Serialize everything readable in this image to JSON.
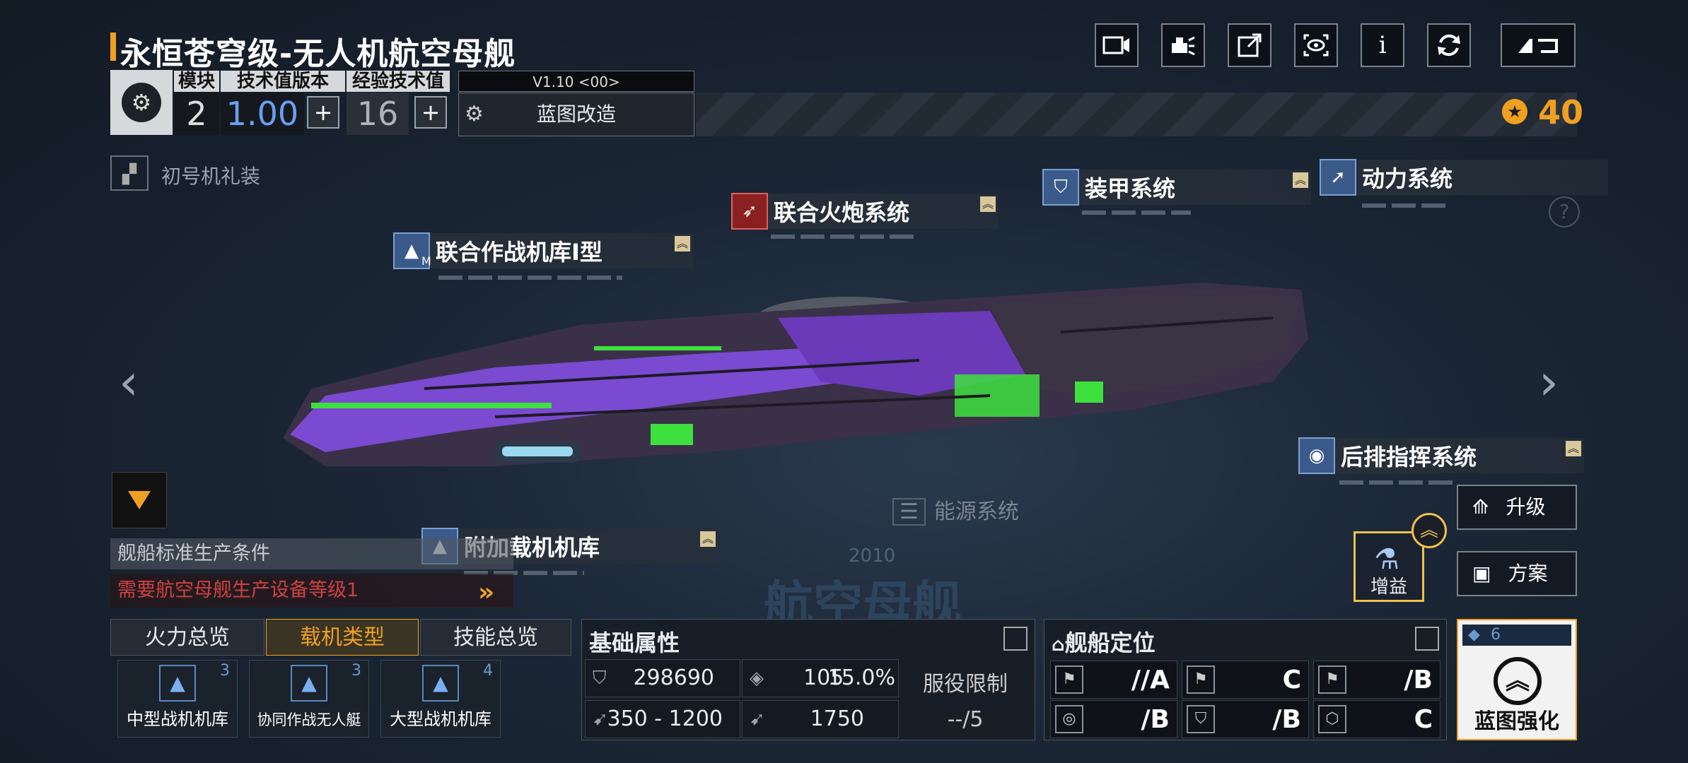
{
  "header": {
    "title": "永恒苍穹级-无人机航空母舰",
    "buttons": [
      "camera-icon",
      "skin-icon",
      "share-icon",
      "view-icon",
      "info-icon",
      "refresh-icon",
      "back-icon"
    ],
    "info_label": "i"
  },
  "module_bar": {
    "col1_label": "模块",
    "col2_label": "技术值版本",
    "col3_label": "经验技术值",
    "module_value": "2",
    "tech_value": "1.00",
    "exp_value": "16",
    "version": "V1.10 <00>",
    "blueprint_label": "蓝图改造",
    "currency_value": "40"
  },
  "skin": {
    "label": "初号机礼装"
  },
  "systems": {
    "hangar1": {
      "name": "联合作战机库Ⅰ型",
      "badge": "M"
    },
    "artillery": {
      "name": "联合火炮系统"
    },
    "armor": {
      "name": "装甲系统"
    },
    "power": {
      "name": "动力系统"
    },
    "rear_command": {
      "name": "后排指挥系统"
    },
    "extra_hangar": {
      "name": "附加载机机库"
    },
    "energy": {
      "name": "能源系统"
    }
  },
  "production": {
    "header": "舰船标准生产条件",
    "requirement": "需要航空母舰生产设备等级1"
  },
  "background": {
    "watermark": "航空母舰",
    "year": "2010"
  },
  "tabs": {
    "items": [
      "火力总览",
      "载机类型",
      "技能总览"
    ],
    "active_index": 1
  },
  "carriers": [
    {
      "name": "中型战机机库",
      "count": "3"
    },
    {
      "name": "协同作战无人艇",
      "count": "3"
    },
    {
      "name": "大型战机机库",
      "count": "4"
    }
  ],
  "attributes": {
    "header": "基础属性",
    "hp": "298690",
    "armor": "105",
    "armor_pct": "15.0%",
    "speed_range": "350 - 1200",
    "warp": "1750",
    "service_label": "服役限制",
    "service_value": "--/5"
  },
  "positioning": {
    "header": "舰船定位",
    "grades": [
      "//A",
      "C",
      "/B",
      "/B",
      "/B",
      "C"
    ]
  },
  "blueprint_enhance": {
    "label": "蓝图强化",
    "level": "6"
  },
  "right_buttons": {
    "upgrade": "升级",
    "plan": "方案",
    "buff": "增益"
  },
  "colors": {
    "accent": "#f0a020",
    "danger": "#d04040",
    "blue_value": "#6aa0f0"
  }
}
